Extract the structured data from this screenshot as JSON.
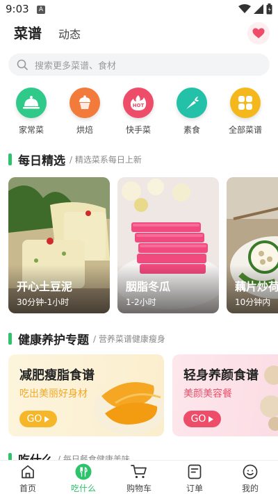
{
  "status_bar": {
    "time": "9:03",
    "notification_badge": "A"
  },
  "header": {
    "tab_recipes": "菜谱",
    "tab_feed": "动态"
  },
  "search": {
    "placeholder": "搜索更多菜谱、食材"
  },
  "categories": [
    {
      "label": "家常菜",
      "icon": "cloche-icon",
      "color": "#2fc98a"
    },
    {
      "label": "烘焙",
      "icon": "cupcake-icon",
      "color": "#f27a3a"
    },
    {
      "label": "快手菜",
      "icon": "hot-icon",
      "color": "#ee4d6a"
    },
    {
      "label": "素食",
      "icon": "carrot-icon",
      "color": "#22c1a8"
    },
    {
      "label": "全部菜谱",
      "icon": "grid-icon",
      "color": "#f5b81c"
    }
  ],
  "daily": {
    "title": "每日精选",
    "subtitle": "/ 精选菜系每日上新",
    "cards": [
      {
        "title": "开心土豆泥",
        "time": "30分钟-1小时"
      },
      {
        "title": "胭脂冬瓜",
        "time": "1-2小时"
      },
      {
        "title": "藕片炒荷",
        "time": "10分钟内"
      }
    ]
  },
  "health": {
    "title": "健康养护专题",
    "subtitle": "/ 营养菜谱健康瘦身",
    "banners": [
      {
        "title": "减肥瘦脂食谱",
        "subtitle": "吃出美丽好身材",
        "go": "GO",
        "color": "#f5b62a"
      },
      {
        "title": "轻身养颜食谱",
        "subtitle": "美颜美容餐",
        "go": "GO",
        "color": "#ee4d6a"
      }
    ]
  },
  "what_to_eat": {
    "title": "吃什么",
    "subtitle": "/ 每日餐食健康美味"
  },
  "bottom_nav": [
    {
      "label": "首页",
      "icon": "home-icon"
    },
    {
      "label": "吃什么",
      "icon": "fork-knife-icon"
    },
    {
      "label": "购物车",
      "icon": "cart-icon"
    },
    {
      "label": "订单",
      "icon": "order-icon"
    },
    {
      "label": "我的",
      "icon": "profile-icon"
    }
  ],
  "colors": {
    "accent": "#2cc36b",
    "heart": "#ee4d6a"
  }
}
